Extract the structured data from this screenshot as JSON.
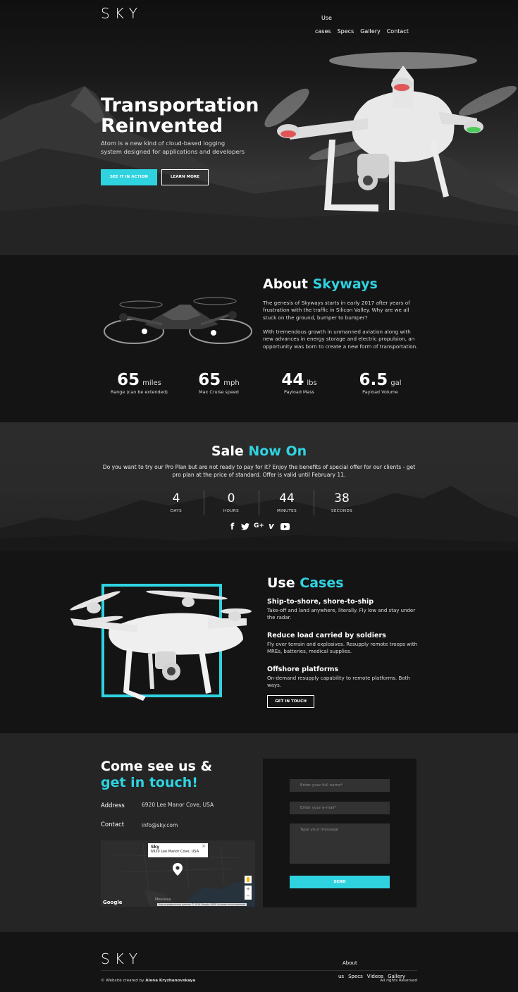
{
  "header": {
    "logo": "SKY",
    "nav": [
      "Use cases",
      "Specs",
      "Gallery",
      "Contact"
    ]
  },
  "hero": {
    "title_line1": "Transportation",
    "title_line2": "Reinvented",
    "subtitle": "Atom is a new kind of cloud-based logging system designed for applications and developers",
    "primary_button": "SEE IT IN ACTION",
    "secondary_button": "LEARN MORE"
  },
  "about": {
    "title_plain": "About",
    "title_accent": "Skyways",
    "paragraph1": "The genesis of Skyways starts in early 2017 after years of frustration with the traffic in Silicon Valley. Why are we all stuck on the ground, bumper to bumper?",
    "paragraph2": "With tremendous growth in unmanned aviation along with new advances in energy storage and electric propulsion, an opportunity was born to create a new form of transportation.",
    "stats": [
      {
        "value": "65",
        "unit": "miles",
        "label": "Range (can be extended)"
      },
      {
        "value": "65",
        "unit": "mph",
        "label": "Max Cruise speed"
      },
      {
        "value": "44",
        "unit": "lbs",
        "label": "Payload Mass"
      },
      {
        "value": "6.5",
        "unit": "gal",
        "label": "Payload Volume"
      }
    ]
  },
  "sale": {
    "title_plain": "Sale",
    "title_accent": "Now On",
    "text": "Do you want to try our Pro Plan but are not ready to pay for it? Enjoy the benefits of special offer for our clients - get pro plan at the price of standard. Offer is valid until February 11.",
    "countdown": [
      {
        "value": "4",
        "label": "DAYS"
      },
      {
        "value": "0",
        "label": "HOURS"
      },
      {
        "value": "44",
        "label": "MINUTES"
      },
      {
        "value": "38",
        "label": "SECONDS"
      }
    ],
    "social_icons": [
      "facebook-icon",
      "twitter-icon",
      "google-plus-icon",
      "vimeo-icon",
      "youtube-icon"
    ],
    "social_glyphs": {
      "facebook": "f",
      "googleplus": "G+",
      "vimeo": "v"
    }
  },
  "use_cases": {
    "title_plain": "Use",
    "title_accent": "Cases",
    "items": [
      {
        "title": "Ship-to-shore, shore-to-ship",
        "text": "Take-off and land anywhere, literally. Fly low and stay under the radar."
      },
      {
        "title": "Reduce load carried by soldiers",
        "text": "Fly over terrain and explosives. Resupply remote troops with MREs, batteries, medical supplies."
      },
      {
        "title": "Offshore platforms",
        "text": "On-demand resupply capability to remote platforms. Both ways."
      }
    ],
    "button": "GET IN TOUCH",
    "accent_color": "#2fd3e0"
  },
  "contact": {
    "title_line1": "Come see us &",
    "title_line2": "get in touch!",
    "address_label": "Address",
    "address_value": "6920 Lee Manor Cove, USA",
    "contact_label": "Contact",
    "contact_value": "info@sky.com",
    "map": {
      "popup_title": "Sky",
      "popup_address": "6920 Lee Manor Cove, USA",
      "popup_close": "×",
      "google_label": "Google",
      "country_label": "Мексика",
      "attribution": "Картографические данные © 2019 Google, INEGI   Условия использования",
      "zoom_in": "+",
      "zoom_out": "−"
    },
    "form": {
      "name_placeholder": "Enter your full name*",
      "email_placeholder": "Enter your e-mail*",
      "message_placeholder": "Type your message",
      "send_button": "SEND"
    }
  },
  "footer": {
    "logo": "SKY",
    "nav": [
      "About us",
      "Specs",
      "Videos",
      "Gallery"
    ],
    "credit_prefix": "© Website created by",
    "credit_name": "Alena Kryzhanovskaya",
    "rights": "All rights Reserved"
  },
  "colors": {
    "accent": "#2fd3e0",
    "background": "#141414",
    "panel": "#252525"
  }
}
